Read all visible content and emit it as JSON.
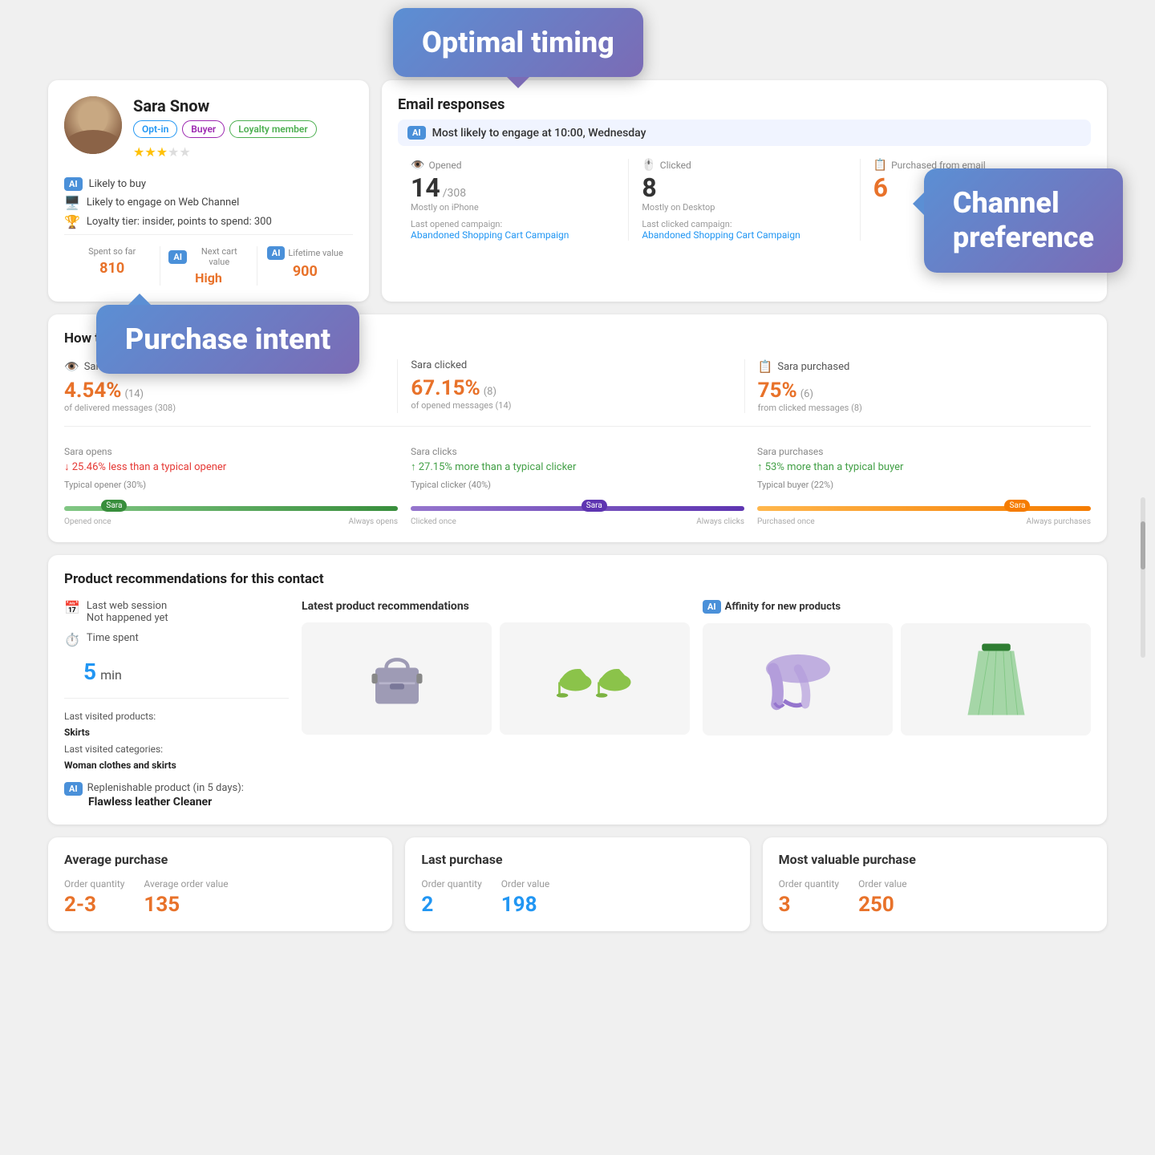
{
  "tooltips": {
    "optimal": "Optimal timing",
    "channel": "Channel\npreference",
    "purchase": "Purchase intent"
  },
  "profile": {
    "name": "Sara Snow",
    "badges": [
      "Opt-in",
      "Buyer",
      "Loyalty member"
    ],
    "stars": 3,
    "traits": [
      {
        "icon": "🤖",
        "text": "Likely to buy",
        "hasAI": true
      },
      {
        "icon": "🖥️",
        "text": "Likely to engage on Web Channel"
      },
      {
        "icon": "🏆",
        "text": "Loyalty tier: insider, points to spend: 300"
      }
    ],
    "stats": {
      "spent": {
        "label": "Spent so far",
        "value": "810"
      },
      "nextCart": {
        "label": "Next cart value",
        "value": "High",
        "hasAI": true
      },
      "lifetime": {
        "label": "Lifetime value",
        "value": "900",
        "hasAI": true
      }
    }
  },
  "emailResponses": {
    "title": "Email responses",
    "optimalTiming": "Most likely to engage at 10:00, Wednesday",
    "metrics": {
      "opened": {
        "label": "Opened",
        "value": "14",
        "total": "/308",
        "sub": "Mostly on iPhone",
        "campaignLabel": "Last opened campaign:",
        "campaignLink": "Abandoned Shopping Cart Campaign"
      },
      "clicked": {
        "label": "Clicked",
        "value": "8",
        "sub": "Mostly on Desktop",
        "campaignLabel": "Last clicked campaign:",
        "campaignLink": "Abandoned Shopping Cart Campaign"
      },
      "purchased": {
        "label": "Purchased from email",
        "value": "6"
      }
    }
  },
  "howSection": {
    "title": "How this contact compares",
    "stats": {
      "opened": {
        "title": "Sara opened",
        "icon": "👁️",
        "percent": "4.54%",
        "count": "(14)",
        "sub": "of delivered messages (308)"
      },
      "clicked": {
        "title": "Sara clicked",
        "percent": "67.15%",
        "count": "(8)",
        "sub": "of opened messages (14)"
      },
      "purchased": {
        "title": "Sara purchased",
        "icon": "📋",
        "percent": "75%",
        "count": "(6)",
        "sub": "from clicked messages (8)"
      }
    },
    "sliders": {
      "opens": {
        "title": "Sara opens",
        "highlight": "↓ 25.46% less than a typical opener",
        "highlightType": "red",
        "typical": "Typical opener (30%)",
        "thumbLabel": "Sara",
        "thumbPos": 15,
        "leftLabel": "Opened once",
        "rightLabel": "Always opens",
        "color": "green"
      },
      "clicks": {
        "title": "Sara clicks",
        "highlight": "↑ 27.15% more than a typical clicker",
        "highlightType": "green",
        "typical": "Typical clicker (40%)",
        "thumbLabel": "Sara",
        "thumbPos": 55,
        "leftLabel": "Clicked once",
        "rightLabel": "Always clicks",
        "color": "purple"
      },
      "purchases": {
        "title": "Sara purchases",
        "highlight": "↑ 53% more than a typical buyer",
        "highlightType": "green",
        "typical": "Typical buyer (22%)",
        "thumbLabel": "Sara",
        "thumbPos": 78,
        "leftLabel": "Purchased once",
        "rightLabel": "Always purchases",
        "color": "orange"
      }
    }
  },
  "productSection": {
    "title": "Product recommendations for this contact",
    "webSession": {
      "label": "Last web session",
      "value": "Not happened yet"
    },
    "timeSpent": {
      "label": "Time spent",
      "value": "5",
      "unit": "min"
    },
    "lastVisited": {
      "productsLabel": "Last visited products:",
      "products": "Skirts",
      "categoriesLabel": "Last visited categories:",
      "categories": "Woman clothes and skirts"
    },
    "replenish": {
      "label": "Replenishable product (in 5 days):",
      "product": "Flawless leather Cleaner"
    },
    "latestTitle": "Latest product recommendations",
    "affinityTitle": "Affinity for new products"
  },
  "purchaseCards": {
    "average": {
      "title": "Average purchase",
      "orderQtyLabel": "Order quantity",
      "orderQtyValue": "2-3",
      "orderValueLabel": "Average order value",
      "orderValueValue": "135"
    },
    "last": {
      "title": "Last purchase",
      "orderQtyLabel": "Order quantity",
      "orderQtyValue": "2",
      "orderValueLabel": "Order value",
      "orderValueValue": "198"
    },
    "mostValuable": {
      "title": "Most valuable purchase",
      "orderQtyLabel": "Order quantity",
      "orderQtyValue": "3",
      "orderValueLabel": "Order value",
      "orderValueValue": "250"
    }
  }
}
